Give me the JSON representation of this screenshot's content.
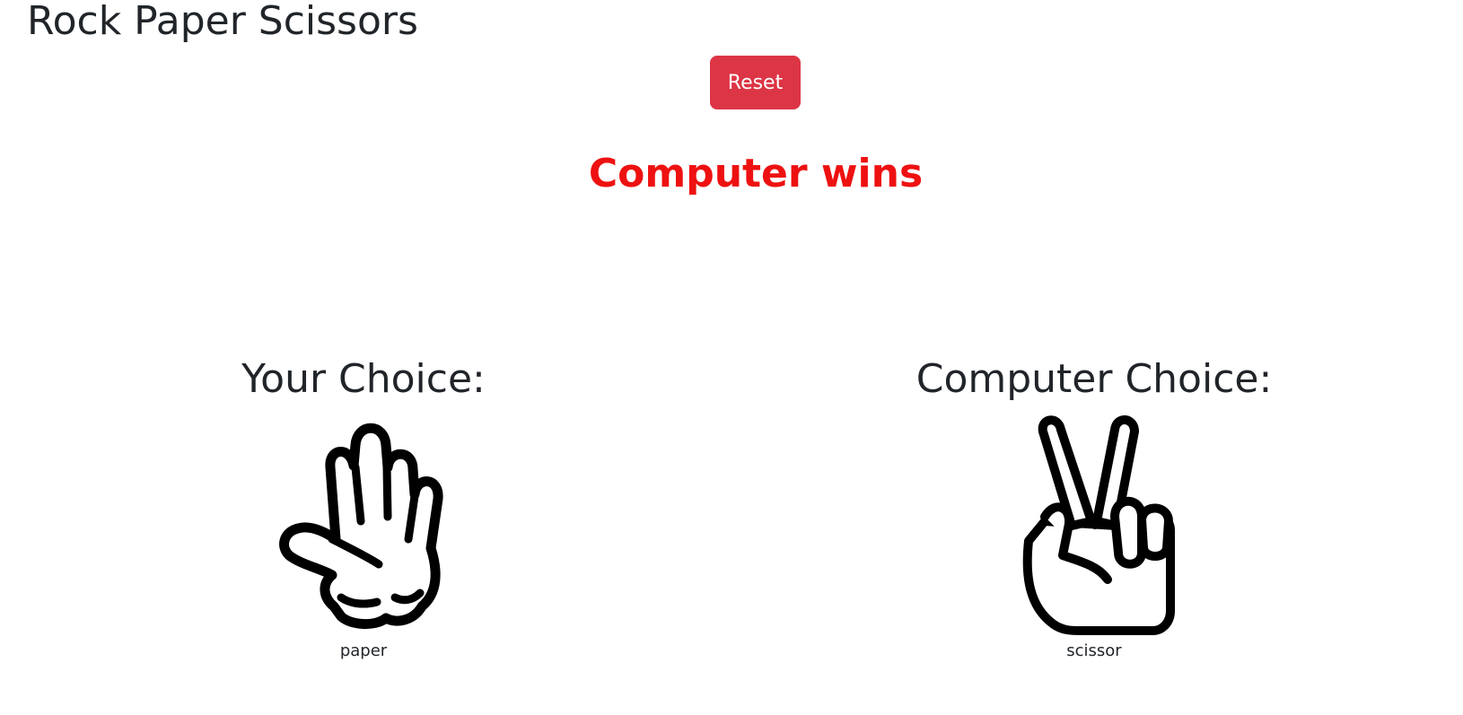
{
  "header": {
    "title": "Rock Paper Scissors"
  },
  "controls": {
    "reset_label": "Reset"
  },
  "result": {
    "text": "Computer wins",
    "color": "#ee1111"
  },
  "player": {
    "heading": "Your Choice:",
    "choice": "paper",
    "icon": "hand-paper-icon"
  },
  "computer": {
    "heading": "Computer Choice:",
    "choice": "scissor",
    "icon": "hand-scissor-icon"
  },
  "colors": {
    "reset_button": "#dc3545",
    "text": "#212529"
  }
}
